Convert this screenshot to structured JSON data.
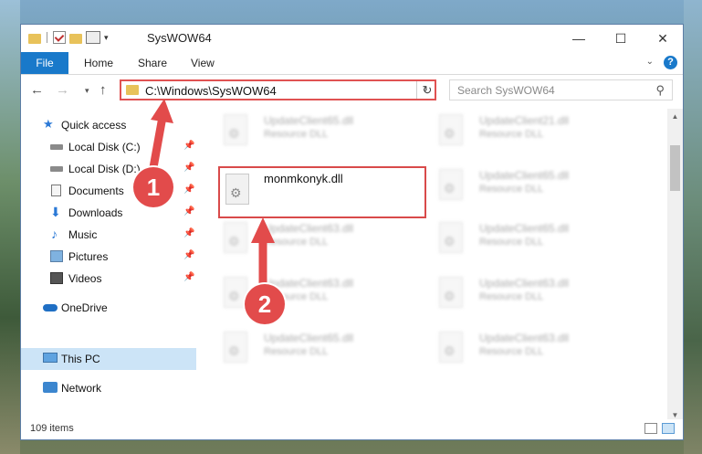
{
  "window": {
    "title": "SysWOW64",
    "controls": {
      "minimize": "—",
      "maximize": "☐",
      "close": "✕"
    }
  },
  "ribbon": {
    "tabs": [
      "File",
      "Home",
      "Share",
      "View"
    ],
    "help": "?"
  },
  "nav": {
    "address": "C:\\Windows\\SysWOW64",
    "search_placeholder": "Search SysWOW64"
  },
  "sidebar": {
    "items": [
      {
        "label": "Quick access",
        "icon": "star-icon"
      },
      {
        "label": "Local Disk (C:)",
        "icon": "drive-icon",
        "pinned": true
      },
      {
        "label": "Local Disk (D:)",
        "icon": "drive-icon",
        "pinned": true
      },
      {
        "label": "Documents",
        "icon": "documents-icon",
        "pinned": true
      },
      {
        "label": "Downloads",
        "icon": "download-icon",
        "pinned": true
      },
      {
        "label": "Music",
        "icon": "music-icon",
        "pinned": true
      },
      {
        "label": "Pictures",
        "icon": "pictures-icon",
        "pinned": true
      },
      {
        "label": "Videos",
        "icon": "video-icon",
        "pinned": true
      },
      {
        "label": "OneDrive",
        "icon": "cloud-icon"
      },
      {
        "label": "This PC",
        "icon": "computer-icon",
        "selected": true
      },
      {
        "label": "Network",
        "icon": "network-icon"
      }
    ]
  },
  "files": {
    "highlighted": {
      "name": "monmkonyk.dll"
    },
    "blurred": [
      {
        "name": "UpdateClient65.dll",
        "type": "Resource DLL"
      },
      {
        "name": "UpdateClient21.dll",
        "type": "Resource DLL"
      },
      {
        "name": "UpdateClient65.dll",
        "type": "Resource DLL"
      },
      {
        "name": "UpdateClient63.dll",
        "type": "Resource DLL"
      },
      {
        "name": "UpdateClient65.dll",
        "type": "Resource DLL"
      },
      {
        "name": "UpdateClient63.dll",
        "type": "Resource DLL"
      },
      {
        "name": "UpdateClient63.dll",
        "type": "Resource DLL"
      },
      {
        "name": "UpdateClient65.dll",
        "type": "Resource DLL"
      },
      {
        "name": "UpdateClient63.dll",
        "type": "Resource DLL"
      }
    ]
  },
  "status": {
    "count": "109 items"
  },
  "callouts": [
    "1",
    "2"
  ],
  "colors": {
    "accent": "#1979ca",
    "highlight": "#d94a4a",
    "callout": "#e24b4b"
  }
}
